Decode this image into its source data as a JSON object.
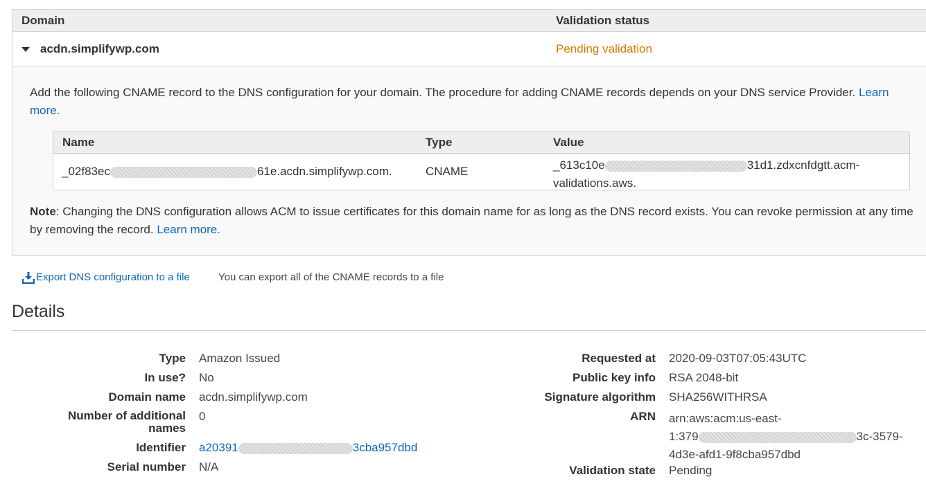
{
  "domain_table": {
    "col_domain": "Domain",
    "col_status": "Validation status",
    "row": {
      "domain": "acdn.simplifywp.com",
      "status": "Pending validation",
      "status_color": "#dd7700"
    },
    "instruction": "Add the following CNAME record to the DNS configuration for your domain. The procedure for adding CNAME records depends on your DNS service Provider.",
    "instruction_link": "Learn more.",
    "cname": {
      "headers": {
        "name": "Name",
        "type": "Type",
        "value": "Value"
      },
      "name_prefix": "_02f83ec",
      "name_suffix": "61e.acdn.simplifywp.com.",
      "type": "CNAME",
      "value_prefix": "_613c10e",
      "value_suffix": "31d1.zdxcnfdgtt.acm-",
      "value_line2": "validations.aws."
    },
    "note_label": "Note",
    "note_text": ": Changing the DNS configuration allows ACM to issue certificates for this domain name for as long as the DNS record exists. You can revoke permission at any time by removing the record.",
    "note_link": "Learn more."
  },
  "export": {
    "icon": "download-icon",
    "link": "Export DNS configuration to a file",
    "hint": "You can export all of the CNAME records to a file"
  },
  "details": {
    "title": "Details",
    "left": {
      "type_label": "Type",
      "type_value": "Amazon Issued",
      "in_use_label": "In use?",
      "in_use_value": "No",
      "domain_label": "Domain name",
      "domain_value": "acdn.simplifywp.com",
      "additional_label_1": "Number of additional",
      "additional_label_2": "names",
      "additional_value": "0",
      "identifier_label": "Identifier",
      "identifier_prefix": "a20391",
      "identifier_suffix": "3cba957dbd",
      "serial_label": "Serial number",
      "serial_value": "N/A"
    },
    "right": {
      "requested_label": "Requested at",
      "requested_value": "2020-09-03T07:05:43UTC",
      "pubkey_label": "Public key info",
      "pubkey_value": "RSA 2048-bit",
      "sig_label": "Signature algorithm",
      "sig_value": "SHA256WITHRSA",
      "arn_label": "ARN",
      "arn_line1": "arn:aws:acm:us-east-",
      "arn_line2_prefix": "1:379",
      "arn_line2_suffix": "3c-3579-",
      "arn_line3": "4d3e-afd1-9f8cba957dbd",
      "state_label": "Validation state",
      "state_value": "Pending"
    }
  }
}
